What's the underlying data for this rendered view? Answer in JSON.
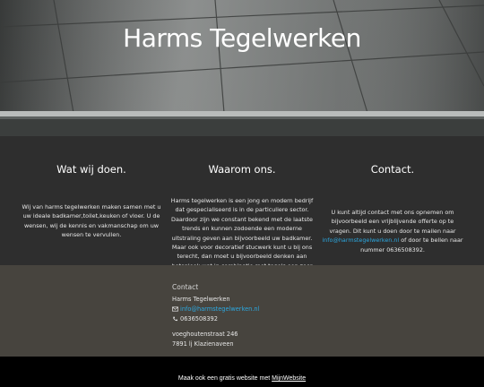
{
  "hero": {
    "title": "Harms Tegelwerken"
  },
  "columns": [
    {
      "heading": "Wat wij doen.",
      "text": "Wij van harms tegelwerken maken samen met u uw ideale badkamer,toilet,keuken of vloer. U de wensen, wij de kennis en vakmanschap om uw wensen te vervullen."
    },
    {
      "heading": "Waarom ons.",
      "text": "Harms tegelwerken is een jong en modern bedrijf dat gespecialiseerd is in de particuliere sector. Daardoor zijn we constant bekend met de laatste trends en kunnen zodoende een moderne uitstraling geven aan bijvoorbeeld uw badkamer. Maar ook voor decoratief stucwerk kunt u bij ons terecht, dan moet u bijvoorbeeld denken aan betonlook wat in combinatie met tegels een zeer luxe en moderne uitstraling geeft."
    },
    {
      "heading": "Contact.",
      "text_before": "U kunt altijd contact met ons opnemen om bijvoorbeeld een vrijblijvende offerte op te vragen. Dit kunt u doen door te mailen naar ",
      "email": "info@harmstegelwerken.nl",
      "text_after": " of door te bellen naar nummer 0636508392."
    }
  ],
  "contact": {
    "title": "Contact",
    "company": "Harms Tegelwerken",
    "email": "info@harmstegelwerken.nl",
    "email_icon": "envelope-icon",
    "phone": "0636508392",
    "phone_icon": "phone-icon",
    "street": "voeghoutenstraat 246",
    "city": "7891 lj Klazienaveen"
  },
  "footer": {
    "text": "Maak ook een gratis website met ",
    "link": "MijnWebsite"
  },
  "colors": {
    "link": "#2ca8e0",
    "info_bg": "#2e2e2e",
    "contact_bg": "#47443e",
    "footer_bg": "#000000"
  }
}
